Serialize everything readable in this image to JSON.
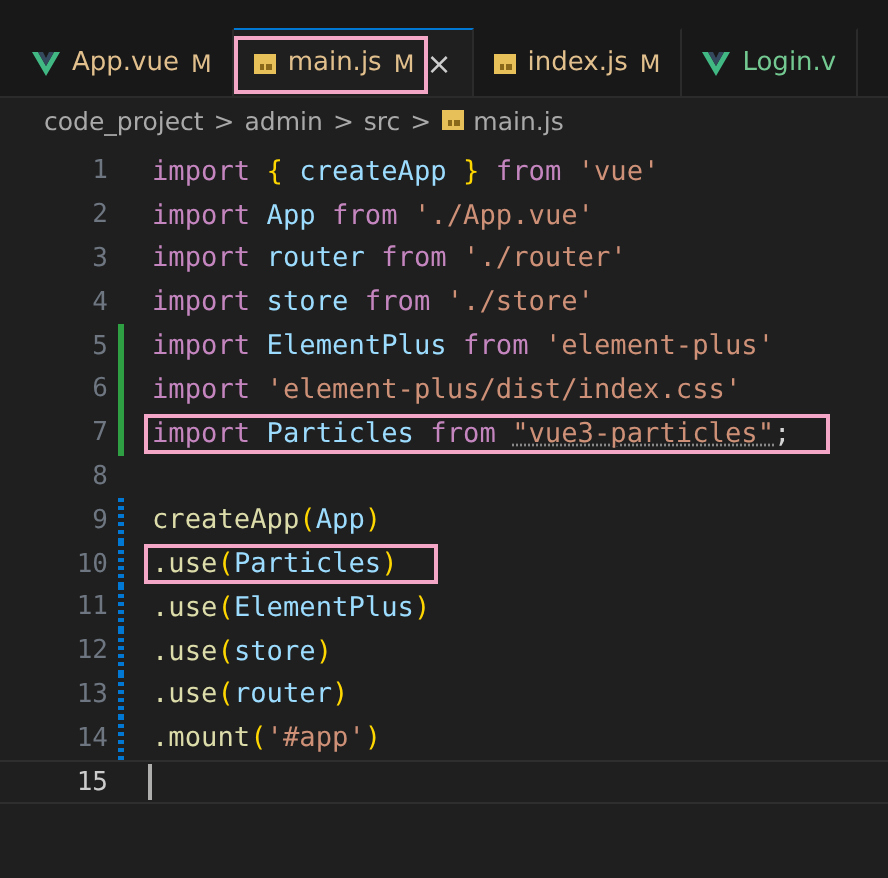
{
  "tabs": [
    {
      "label": "App.vue",
      "kind": "vue",
      "color": "#e2c08d",
      "badge": "M",
      "selected": false,
      "boxed": false
    },
    {
      "label": "main.js",
      "kind": "js",
      "color": "#e2c08d",
      "badge": "M",
      "selected": true,
      "boxed": true,
      "close": "×"
    },
    {
      "label": "index.js",
      "kind": "js",
      "color": "#e2c08d",
      "badge": "M",
      "selected": false,
      "boxed": false
    },
    {
      "label": "Login.v",
      "kind": "vue",
      "color": "#73c991",
      "selected": false,
      "boxed": false
    }
  ],
  "breadcrumb": {
    "folders": [
      "code_project",
      "admin",
      "src"
    ],
    "separator": ">",
    "file": {
      "label": "main.js",
      "kind": "js"
    }
  },
  "lines": [
    {
      "number": "1",
      "current": false,
      "tokens": [
        {
          "t": "import ",
          "kind": "kw"
        },
        {
          "t": "{ ",
          "kind": "brace"
        },
        {
          "t": "createApp ",
          "kind": "var"
        },
        {
          "t": "} ",
          "kind": "brace"
        },
        {
          "t": "from ",
          "kind": "kw"
        },
        {
          "t": "'vue'",
          "kind": "str"
        }
      ]
    },
    {
      "number": "2",
      "current": false,
      "tokens": [
        {
          "t": "import ",
          "kind": "kw"
        },
        {
          "t": "App ",
          "kind": "var"
        },
        {
          "t": "from ",
          "kind": "kw"
        },
        {
          "t": "'./App.vue'",
          "kind": "str"
        }
      ]
    },
    {
      "number": "3",
      "current": false,
      "tokens": [
        {
          "t": "import ",
          "kind": "kw"
        },
        {
          "t": "router ",
          "kind": "var"
        },
        {
          "t": "from ",
          "kind": "kw"
        },
        {
          "t": "'./router'",
          "kind": "str"
        }
      ]
    },
    {
      "number": "4",
      "current": false,
      "tokens": [
        {
          "t": "import ",
          "kind": "kw"
        },
        {
          "t": "store ",
          "kind": "var"
        },
        {
          "t": "from ",
          "kind": "kw"
        },
        {
          "t": "'./store'",
          "kind": "str"
        }
      ]
    },
    {
      "number": "5",
      "kind": "added",
      "current": false,
      "tokens": [
        {
          "t": "import ",
          "kind": "kw"
        },
        {
          "t": "ElementPlus ",
          "kind": "var"
        },
        {
          "t": "from ",
          "kind": "kw"
        },
        {
          "t": "'element-plus'",
          "kind": "str"
        }
      ]
    },
    {
      "number": "6",
      "kind": "added",
      "current": false,
      "tokens": [
        {
          "t": "import ",
          "kind": "kw"
        },
        {
          "t": "'element-plus/dist/index.css'",
          "kind": "str"
        }
      ]
    },
    {
      "number": "7",
      "kind": "added",
      "current": false,
      "boxed": true,
      "tokens": [
        {
          "t": "import ",
          "kind": "kw"
        },
        {
          "t": "Particles ",
          "kind": "var"
        },
        {
          "t": "from ",
          "kind": "kw"
        },
        {
          "t": "\"vue3-particles\"",
          "kind": "str",
          "hint": true
        },
        {
          "t": ";",
          "kind": "plain"
        }
      ]
    },
    {
      "number": "8",
      "current": false
    },
    {
      "number": "9",
      "kind": "modified",
      "current": false,
      "tokens": [
        {
          "t": "createApp",
          "kind": "fn"
        },
        {
          "t": "(",
          "kind": "brace"
        },
        {
          "t": "App",
          "kind": "var"
        },
        {
          "t": ")",
          "kind": "brace"
        }
      ]
    },
    {
      "number": "10",
      "kind": "modified",
      "current": false,
      "boxed": true,
      "tokens": [
        {
          "t": ".use",
          "kind": "fn"
        },
        {
          "t": "(",
          "kind": "brace"
        },
        {
          "t": "Particles",
          "kind": "var"
        },
        {
          "t": ")",
          "kind": "brace"
        }
      ]
    },
    {
      "number": "11",
      "kind": "modified",
      "current": false,
      "tokens": [
        {
          "t": ".use",
          "kind": "fn"
        },
        {
          "t": "(",
          "kind": "brace"
        },
        {
          "t": "ElementPlus",
          "kind": "var"
        },
        {
          "t": ")",
          "kind": "brace"
        }
      ]
    },
    {
      "number": "12",
      "kind": "modified",
      "current": false,
      "tokens": [
        {
          "t": ".use",
          "kind": "fn"
        },
        {
          "t": "(",
          "kind": "brace"
        },
        {
          "t": "store",
          "kind": "var"
        },
        {
          "t": ")",
          "kind": "brace"
        }
      ]
    },
    {
      "number": "13",
      "kind": "modified",
      "current": false,
      "tokens": [
        {
          "t": ".use",
          "kind": "fn"
        },
        {
          "t": "(",
          "kind": "brace"
        },
        {
          "t": "router",
          "kind": "var"
        },
        {
          "t": ")",
          "kind": "brace"
        }
      ]
    },
    {
      "number": "14",
      "kind": "modified",
      "current": false,
      "tokens": [
        {
          "t": ".mount",
          "kind": "fn"
        },
        {
          "t": "(",
          "kind": "brace"
        },
        {
          "t": "'#app'",
          "kind": "str"
        },
        {
          "t": ")",
          "kind": "brace"
        }
      ]
    },
    {
      "number": "15",
      "current": true
    }
  ]
}
